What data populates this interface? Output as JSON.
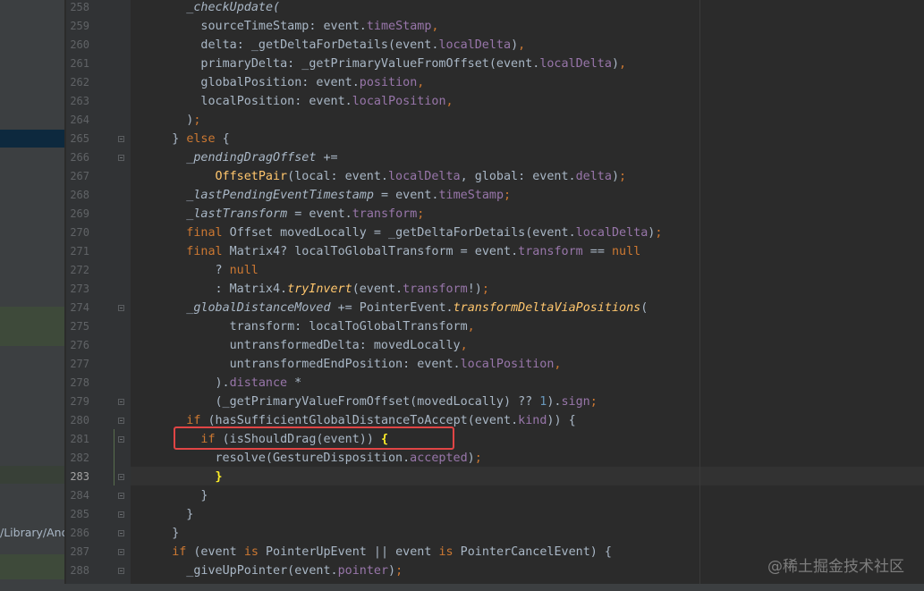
{
  "project_panel": {
    "path_text": "/Library/And"
  },
  "gutter": {
    "current_line": "283",
    "line_numbers": [
      "258",
      "259",
      "260",
      "261",
      "262",
      "263",
      "264",
      "265",
      "266",
      "267",
      "268",
      "269",
      "270",
      "271",
      "272",
      "273",
      "274",
      "275",
      "276",
      "277",
      "278",
      "279",
      "280",
      "281",
      "282",
      "283",
      "284",
      "285",
      "286",
      "287",
      "288"
    ]
  },
  "editor": {
    "lines": [
      {
        "indent": 6,
        "segs": [
          [
            "_checkUpdate(",
            "it"
          ]
        ]
      },
      {
        "indent": 8,
        "segs": [
          [
            "sourceTimeStamp: event.",
            ""
          ],
          [
            "timeStamp",
            "fld"
          ],
          [
            ",",
            "kw"
          ]
        ]
      },
      {
        "indent": 8,
        "segs": [
          [
            "delta: _getDeltaForDetails(event.",
            ""
          ],
          [
            "localDelta",
            "fld"
          ],
          [
            ")",
            ""
          ],
          [
            ",",
            "kw"
          ]
        ]
      },
      {
        "indent": 8,
        "segs": [
          [
            "primaryDelta: _getPrimaryValueFromOffset(event.",
            ""
          ],
          [
            "localDelta",
            "fld"
          ],
          [
            ")",
            ""
          ],
          [
            ",",
            "kw"
          ]
        ]
      },
      {
        "indent": 8,
        "segs": [
          [
            "globalPosition: event.",
            ""
          ],
          [
            "position",
            "fld"
          ],
          [
            ",",
            "kw"
          ]
        ]
      },
      {
        "indent": 8,
        "segs": [
          [
            "localPosition: event.",
            ""
          ],
          [
            "localPosition",
            "fld"
          ],
          [
            ",",
            "kw"
          ]
        ]
      },
      {
        "indent": 6,
        "segs": [
          [
            ")",
            ""
          ],
          [
            ";",
            "kw"
          ]
        ]
      },
      {
        "indent": 4,
        "segs": [
          [
            "} ",
            ""
          ],
          [
            "else",
            "kw"
          ],
          [
            " {",
            ""
          ]
        ]
      },
      {
        "indent": 6,
        "segs": [
          [
            "_pendingDragOffset",
            "it"
          ],
          [
            " +=",
            ""
          ]
        ]
      },
      {
        "indent": 10,
        "segs": [
          [
            "OffsetPair",
            "fn"
          ],
          [
            "(local: event.",
            ""
          ],
          [
            "localDelta",
            "fld"
          ],
          [
            ", global: event.",
            ""
          ],
          [
            "delta",
            "fld"
          ],
          [
            ")",
            ""
          ],
          [
            ";",
            "kw"
          ]
        ]
      },
      {
        "indent": 6,
        "segs": [
          [
            "_lastPendingEventTimestamp",
            "it"
          ],
          [
            " = event.",
            ""
          ],
          [
            "timeStamp",
            "fld"
          ],
          [
            ";",
            "kw"
          ]
        ]
      },
      {
        "indent": 6,
        "segs": [
          [
            "_lastTransform",
            "it"
          ],
          [
            " = event.",
            ""
          ],
          [
            "transform",
            "fld"
          ],
          [
            ";",
            "kw"
          ]
        ]
      },
      {
        "indent": 6,
        "segs": [
          [
            "final",
            "kw"
          ],
          [
            " Offset movedLocally = _getDeltaForDetails(event.",
            ""
          ],
          [
            "localDelta",
            "fld"
          ],
          [
            ")",
            ""
          ],
          [
            ";",
            "kw"
          ]
        ]
      },
      {
        "indent": 6,
        "segs": [
          [
            "final",
            "kw"
          ],
          [
            " Matrix4? localToGlobalTransform = event.",
            ""
          ],
          [
            "transform",
            "fld"
          ],
          [
            " == ",
            ""
          ],
          [
            "null",
            "kw"
          ]
        ]
      },
      {
        "indent": 10,
        "segs": [
          [
            "? ",
            ""
          ],
          [
            "null",
            "kw"
          ]
        ]
      },
      {
        "indent": 10,
        "segs": [
          [
            ": Matrix4.",
            ""
          ],
          [
            "tryInvert",
            "fn it"
          ],
          [
            "(event.",
            ""
          ],
          [
            "transform",
            "fld"
          ],
          [
            "!)",
            ""
          ],
          [
            ";",
            "kw"
          ]
        ]
      },
      {
        "indent": 6,
        "segs": [
          [
            "_globalDistanceMoved",
            "it"
          ],
          [
            " += PointerEvent.",
            ""
          ],
          [
            "transformDeltaViaPositions",
            "fn it"
          ],
          [
            "(",
            ""
          ]
        ]
      },
      {
        "indent": 12,
        "segs": [
          [
            "transform: localToGlobalTransform",
            ""
          ],
          [
            ",",
            "kw"
          ]
        ]
      },
      {
        "indent": 12,
        "segs": [
          [
            "untransformedDelta: movedLocally",
            ""
          ],
          [
            ",",
            "kw"
          ]
        ]
      },
      {
        "indent": 12,
        "segs": [
          [
            "untransformedEndPosition: event.",
            ""
          ],
          [
            "localPosition",
            "fld"
          ],
          [
            ",",
            "kw"
          ]
        ]
      },
      {
        "indent": 10,
        "segs": [
          [
            ").",
            ""
          ],
          [
            "distance",
            "fld"
          ],
          [
            " *",
            ""
          ]
        ]
      },
      {
        "indent": 10,
        "segs": [
          [
            "(_getPrimaryValueFromOffset(movedLocally) ?? ",
            ""
          ],
          [
            "1",
            "num"
          ],
          [
            ").",
            ""
          ],
          [
            "sign",
            "fld"
          ],
          [
            ";",
            "kw"
          ]
        ]
      },
      {
        "indent": 6,
        "segs": [
          [
            "if",
            "kw"
          ],
          [
            " (hasSufficientGlobalDistanceToAccept(event.",
            ""
          ],
          [
            "kind",
            "fld"
          ],
          [
            ")) {",
            ""
          ]
        ]
      },
      {
        "indent": 8,
        "segs": [
          [
            "if",
            "kw"
          ],
          [
            " (isShouldDrag(event)) ",
            ""
          ],
          [
            "{",
            "brace-match"
          ]
        ]
      },
      {
        "indent": 10,
        "segs": [
          [
            "resolve(GestureDisposition.",
            ""
          ],
          [
            "accepted",
            "fld"
          ],
          [
            ")",
            ""
          ],
          [
            ";",
            "kw"
          ]
        ]
      },
      {
        "indent": 10,
        "segs": [
          [
            "}",
            "brace-match"
          ]
        ]
      },
      {
        "indent": 8,
        "segs": [
          [
            "}",
            ""
          ]
        ]
      },
      {
        "indent": 6,
        "segs": [
          [
            "}",
            ""
          ]
        ]
      },
      {
        "indent": 4,
        "segs": [
          [
            "}",
            ""
          ]
        ]
      },
      {
        "indent": 4,
        "segs": [
          [
            "if",
            "kw"
          ],
          [
            " (event ",
            ""
          ],
          [
            "is",
            "kw"
          ],
          [
            " PointerUpEvent || event ",
            ""
          ],
          [
            "is",
            "kw"
          ],
          [
            " PointerCancelEvent) {",
            ""
          ]
        ]
      },
      {
        "indent": 6,
        "segs": [
          [
            "_giveUpPointer(event.",
            ""
          ],
          [
            "pointer",
            "fld"
          ],
          [
            ")",
            ""
          ],
          [
            ";",
            "kw"
          ]
        ]
      }
    ]
  },
  "watermark": {
    "text": "@稀土掘金技术社区"
  },
  "colors": {
    "background": "#2b2b2b",
    "gutter": "#313335",
    "keyword": "#cc7832",
    "field": "#9876aa",
    "function": "#ffc66d",
    "number": "#6897bb",
    "default_text": "#a9b7c6",
    "highlight_box": "#e04545",
    "brace_match": "#ffef28"
  }
}
